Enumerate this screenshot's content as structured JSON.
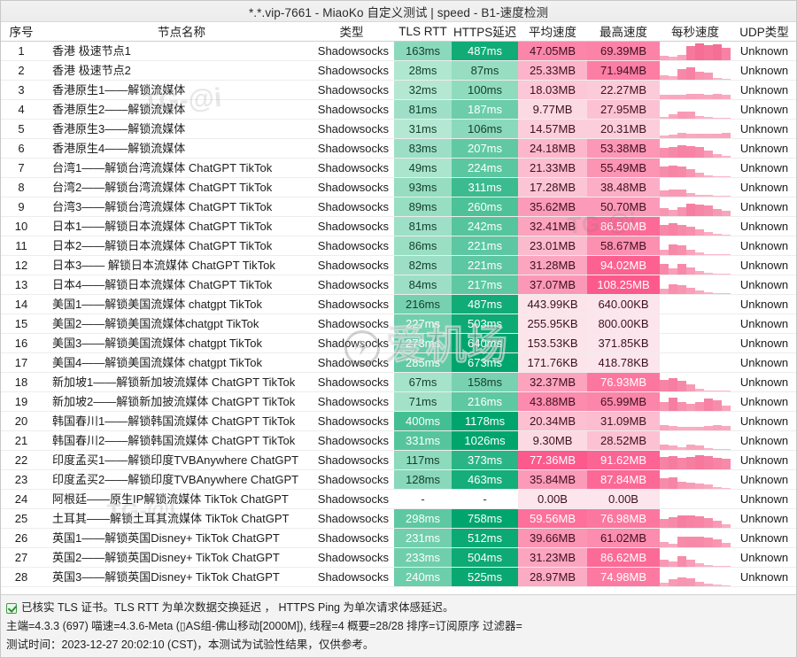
{
  "window": {
    "title": "*.*.vip-7661 - MiaoKo 自定义测试 | speed - B1-速度检测"
  },
  "columns": {
    "index": "序号",
    "name": "节点名称",
    "type": "类型",
    "tls_rtt": "TLS RTT",
    "https_ping": "HTTPS延迟",
    "avg_speed": "平均速度",
    "max_speed": "最高速度",
    "per_second": "每秒速度",
    "udp_type": "UDP类型"
  },
  "watermarks": {
    "a": "TG-@i",
    "b": "TG-@i",
    "c": "TG-@i",
    "big": "爱机场",
    "big_mark": "✈"
  },
  "rows": [
    {
      "index": "1",
      "name": "香港 极速节点1",
      "type": "Shadowsocks",
      "tls_rtt": "163ms",
      "https_ping": "487ms",
      "avg_speed": "47.05MB",
      "max_speed": "69.39MB",
      "udp_type": "Unknown",
      "rtt_shade": 0.35,
      "ping_shade": 0.92,
      "avg_shade": 0.7,
      "max_shade": 0.72,
      "spark": [
        0.25,
        0.18,
        0.3,
        0.8,
        0.95,
        0.88,
        0.92,
        0.7
      ]
    },
    {
      "index": "2",
      "name": "香港 极速节点2",
      "type": "Shadowsocks",
      "tls_rtt": "28ms",
      "https_ping": "87ms",
      "avg_speed": "25.33MB",
      "max_speed": "71.94MB",
      "udp_type": "Unknown",
      "rtt_shade": 0.18,
      "ping_shade": 0.3,
      "avg_shade": 0.38,
      "max_shade": 0.75,
      "spark": [
        0.22,
        0.18,
        0.62,
        0.7,
        0.45,
        0.4,
        0.1,
        0.05
      ]
    },
    {
      "index": "3",
      "name": "香港原生1——解锁流媒体",
      "type": "Shadowsocks",
      "tls_rtt": "32ms",
      "https_ping": "100ms",
      "avg_speed": "18.03MB",
      "max_speed": "22.27MB",
      "udp_type": "Unknown",
      "rtt_shade": 0.16,
      "ping_shade": 0.33,
      "avg_shade": 0.25,
      "max_shade": 0.22,
      "spark": [
        0.22,
        0.26,
        0.24,
        0.3,
        0.28,
        0.26,
        0.3,
        0.22
      ]
    },
    {
      "index": "4",
      "name": "香港原生2——解锁流媒体",
      "type": "Shadowsocks",
      "tls_rtt": "81ms",
      "https_ping": "187ms",
      "avg_speed": "9.77MB",
      "max_speed": "27.95MB",
      "udp_type": "Unknown",
      "rtt_shade": 0.26,
      "ping_shade": 0.5,
      "avg_shade": 0.12,
      "max_shade": 0.28,
      "spark": [
        0.08,
        0.26,
        0.42,
        0.38,
        0.12,
        0.06,
        0.04,
        0.03
      ]
    },
    {
      "index": "5",
      "name": "香港原生3——解锁流媒体",
      "type": "Shadowsocks",
      "tls_rtt": "31ms",
      "https_ping": "106ms",
      "avg_speed": "14.57MB",
      "max_speed": "20.31MB",
      "udp_type": "Unknown",
      "rtt_shade": 0.16,
      "ping_shade": 0.35,
      "avg_shade": 0.2,
      "max_shade": 0.2,
      "spark": [
        0.14,
        0.2,
        0.3,
        0.22,
        0.26,
        0.24,
        0.26,
        0.3
      ]
    },
    {
      "index": "6",
      "name": "香港原生4——解锁流媒体",
      "type": "Shadowsocks",
      "tls_rtt": "83ms",
      "https_ping": "207ms",
      "avg_speed": "24.18MB",
      "max_speed": "53.38MB",
      "udp_type": "Unknown",
      "rtt_shade": 0.27,
      "ping_shade": 0.55,
      "avg_shade": 0.36,
      "max_shade": 0.58,
      "spark": [
        0.55,
        0.62,
        0.7,
        0.68,
        0.6,
        0.4,
        0.2,
        0.08
      ]
    },
    {
      "index": "7",
      "name": "台湾1——解锁台湾流媒体 ChatGPT  TikTok",
      "type": "Shadowsocks",
      "tls_rtt": "49ms",
      "https_ping": "224ms",
      "avg_speed": "21.33MB",
      "max_speed": "55.49MB",
      "udp_type": "Unknown",
      "rtt_shade": 0.2,
      "ping_shade": 0.58,
      "avg_shade": 0.32,
      "max_shade": 0.6,
      "spark": [
        0.58,
        0.66,
        0.62,
        0.45,
        0.25,
        0.1,
        0.05,
        0.03
      ]
    },
    {
      "index": "8",
      "name": "台湾2——解锁台湾流媒体 ChatGPT  TikTok",
      "type": "Shadowsocks",
      "tls_rtt": "93ms",
      "https_ping": "311ms",
      "avg_speed": "17.28MB",
      "max_speed": "38.48MB",
      "udp_type": "Unknown",
      "rtt_shade": 0.3,
      "ping_shade": 0.72,
      "avg_shade": 0.26,
      "max_shade": 0.42,
      "spark": [
        0.35,
        0.42,
        0.4,
        0.2,
        0.1,
        0.06,
        0.04,
        0.02
      ]
    },
    {
      "index": "9",
      "name": "台湾3——解锁台湾流媒体 ChatGPT  TikTok",
      "type": "Shadowsocks",
      "tls_rtt": "89ms",
      "https_ping": "260ms",
      "avg_speed": "35.62MB",
      "max_speed": "50.70MB",
      "udp_type": "Unknown",
      "rtt_shade": 0.29,
      "ping_shade": 0.64,
      "avg_shade": 0.55,
      "max_shade": 0.55,
      "spark": [
        0.45,
        0.32,
        0.5,
        0.72,
        0.66,
        0.58,
        0.42,
        0.3
      ]
    },
    {
      "index": "10",
      "name": "日本1——解锁日本流媒体 ChatGPT  TikTok",
      "type": "Shadowsocks",
      "tls_rtt": "81ms",
      "https_ping": "242ms",
      "avg_speed": "32.41MB",
      "max_speed": "86.50MB",
      "udp_type": "Unknown",
      "rtt_shade": 0.26,
      "ping_shade": 0.6,
      "avg_shade": 0.5,
      "max_shade": 0.88,
      "spark": [
        0.62,
        0.7,
        0.6,
        0.52,
        0.35,
        0.18,
        0.08,
        0.04
      ]
    },
    {
      "index": "11",
      "name": "日本2——解锁日本流媒体 ChatGPT  TikTok",
      "type": "Shadowsocks",
      "tls_rtt": "86ms",
      "https_ping": "221ms",
      "avg_speed": "23.01MB",
      "max_speed": "58.67MB",
      "udp_type": "Unknown",
      "rtt_shade": 0.28,
      "ping_shade": 0.57,
      "avg_shade": 0.34,
      "max_shade": 0.63,
      "spark": [
        0.3,
        0.62,
        0.55,
        0.3,
        0.12,
        0.05,
        0.03,
        0.02
      ]
    },
    {
      "index": "12",
      "name": "日本3—— 解锁日本流媒体 ChatGPT  TikTok",
      "type": "Shadowsocks",
      "tls_rtt": "82ms",
      "https_ping": "221ms",
      "avg_speed": "31.28MB",
      "max_speed": "94.02MB",
      "udp_type": "Unknown",
      "rtt_shade": 0.27,
      "ping_shade": 0.57,
      "avg_shade": 0.48,
      "max_shade": 0.95,
      "spark": [
        0.62,
        0.35,
        0.6,
        0.38,
        0.2,
        0.06,
        0.03,
        0.02
      ]
    },
    {
      "index": "13",
      "name": "日本4——解锁日本流媒体 ChatGPT  TikTok",
      "type": "Shadowsocks",
      "tls_rtt": "84ms",
      "https_ping": "217ms",
      "avg_speed": "37.07MB",
      "max_speed": "108.25MB",
      "udp_type": "Unknown",
      "rtt_shade": 0.27,
      "ping_shade": 0.56,
      "avg_shade": 0.57,
      "max_shade": 1.0,
      "spark": [
        0.3,
        0.55,
        0.48,
        0.35,
        0.2,
        0.1,
        0.05,
        0.03
      ]
    },
    {
      "index": "14",
      "name": "美国1——解锁美国流媒体 chatgpt TikTok",
      "type": "Shadowsocks",
      "tls_rtt": "216ms",
      "https_ping": "487ms",
      "avg_speed": "443.99KB",
      "max_speed": "640.00KB",
      "udp_type": "Unknown",
      "rtt_shade": 0.45,
      "ping_shade": 0.92,
      "avg_shade": 0.05,
      "max_shade": 0.04,
      "spark": []
    },
    {
      "index": "15",
      "name": "美国2——解锁美国流媒体chatgpt TikTok",
      "type": "Shadowsocks",
      "tls_rtt": "227ms",
      "https_ping": "503ms",
      "avg_speed": "255.95KB",
      "max_speed": "800.00KB",
      "udp_type": "Unknown",
      "rtt_shade": 0.47,
      "ping_shade": 0.94,
      "avg_shade": 0.05,
      "max_shade": 0.04,
      "spark": []
    },
    {
      "index": "16",
      "name": "美国3——解锁美国流媒体 chatgpt TikTok",
      "type": "Shadowsocks",
      "tls_rtt": "273ms",
      "https_ping": "640ms",
      "avg_speed": "153.53KB",
      "max_speed": "371.85KB",
      "udp_type": "Unknown",
      "rtt_shade": 0.52,
      "ping_shade": 1.0,
      "avg_shade": 0.05,
      "max_shade": 0.04,
      "spark": []
    },
    {
      "index": "17",
      "name": "美国4——解锁美国流媒体 chatgpt TikTok",
      "type": "Shadowsocks",
      "tls_rtt": "285ms",
      "https_ping": "673ms",
      "avg_speed": "171.76KB",
      "max_speed": "418.78KB",
      "udp_type": "Unknown",
      "rtt_shade": 0.54,
      "ping_shade": 1.0,
      "avg_shade": 0.05,
      "max_shade": 0.04,
      "spark": []
    },
    {
      "index": "18",
      "name": "新加坡1——解锁新加坡流媒体 ChatGPT  TikTok",
      "type": "Shadowsocks",
      "tls_rtt": "67ms",
      "https_ping": "158ms",
      "avg_speed": "32.37MB",
      "max_speed": "76.93MB",
      "udp_type": "Unknown",
      "rtt_shade": 0.23,
      "ping_shade": 0.44,
      "avg_shade": 0.5,
      "max_shade": 0.8,
      "spark": [
        0.68,
        0.74,
        0.62,
        0.4,
        0.12,
        0.05,
        0.03,
        0.02
      ]
    },
    {
      "index": "19",
      "name": "新加坡2——解锁新加披流媒体 ChatGPT  TikTok",
      "type": "Shadowsocks",
      "tls_rtt": "71ms",
      "https_ping": "216ms",
      "avg_speed": "43.88MB",
      "max_speed": "65.99MB",
      "udp_type": "Unknown",
      "rtt_shade": 0.24,
      "ping_shade": 0.56,
      "avg_shade": 0.66,
      "max_shade": 0.7,
      "spark": [
        0.48,
        0.74,
        0.52,
        0.4,
        0.52,
        0.7,
        0.58,
        0.3
      ]
    },
    {
      "index": "20",
      "name": "韩国春川1——解锁韩国流媒体 ChatGPT  TikTok",
      "type": "Shadowsocks",
      "tls_rtt": "400ms",
      "https_ping": "1178ms",
      "avg_speed": "20.34MB",
      "max_speed": "31.09MB",
      "udp_type": "Unknown",
      "rtt_shade": 0.68,
      "ping_shade": 1.0,
      "avg_shade": 0.3,
      "max_shade": 0.32,
      "spark": [
        0.28,
        0.22,
        0.18,
        0.16,
        0.2,
        0.26,
        0.3,
        0.24
      ]
    },
    {
      "index": "21",
      "name": "韩国春川2——解锁韩国流媒体 ChatGPT  TikTok",
      "type": "Shadowsocks",
      "tls_rtt": "331ms",
      "https_ping": "1026ms",
      "avg_speed": "9.30MB",
      "max_speed": "28.52MB",
      "udp_type": "Unknown",
      "rtt_shade": 0.6,
      "ping_shade": 1.0,
      "avg_shade": 0.12,
      "max_shade": 0.29,
      "spark": [
        0.3,
        0.22,
        0.12,
        0.28,
        0.26,
        0.1,
        0.04,
        0.02
      ]
    },
    {
      "index": "22",
      "name": "印度孟买1——解锁印度TVBAnywhere  ChatGPT",
      "type": "Shadowsocks",
      "tls_rtt": "117ms",
      "https_ping": "373ms",
      "avg_speed": "77.36MB",
      "max_speed": "91.62MB",
      "udp_type": "Unknown",
      "rtt_shade": 0.34,
      "ping_shade": 0.8,
      "avg_shade": 1.0,
      "max_shade": 0.93,
      "spark": [
        0.7,
        0.76,
        0.66,
        0.72,
        0.8,
        0.74,
        0.68,
        0.6
      ]
    },
    {
      "index": "23",
      "name": "印度孟买2——解锁印度TVBAnywhere  ChatGPT",
      "type": "Shadowsocks",
      "tls_rtt": "128ms",
      "https_ping": "463ms",
      "avg_speed": "35.84MB",
      "max_speed": "87.84MB",
      "udp_type": "Unknown",
      "rtt_shade": 0.36,
      "ping_shade": 0.9,
      "avg_shade": 0.55,
      "max_shade": 0.9,
      "spark": [
        0.58,
        0.66,
        0.42,
        0.36,
        0.3,
        0.22,
        0.1,
        0.05
      ]
    },
    {
      "index": "24",
      "name": "阿根廷——原生IP解锁流媒体 TikTok  ChatGPT",
      "type": "Shadowsocks",
      "tls_rtt": "-",
      "https_ping": "-",
      "avg_speed": "0.00B",
      "max_speed": "0.00B",
      "udp_type": "Unknown",
      "rtt_shade": 0,
      "ping_shade": 0,
      "avg_shade": 0.04,
      "max_shade": 0.04,
      "spark": []
    },
    {
      "index": "25",
      "name": "土耳其——解锁土耳其流媒体 TikTok ChatGPT",
      "type": "Shadowsocks",
      "tls_rtt": "298ms",
      "https_ping": "758ms",
      "avg_speed": "59.56MB",
      "max_speed": "76.98MB",
      "udp_type": "Unknown",
      "rtt_shade": 0.56,
      "ping_shade": 1.0,
      "avg_shade": 0.85,
      "max_shade": 0.8,
      "spark": [
        0.52,
        0.6,
        0.72,
        0.7,
        0.66,
        0.56,
        0.4,
        0.2
      ]
    },
    {
      "index": "26",
      "name": "英国1——解锁英国Disney+ TikTok  ChatGPT",
      "type": "Shadowsocks",
      "tls_rtt": "231ms",
      "https_ping": "512ms",
      "avg_speed": "39.66MB",
      "max_speed": "61.02MB",
      "udp_type": "Unknown",
      "rtt_shade": 0.47,
      "ping_shade": 0.95,
      "avg_shade": 0.6,
      "max_shade": 0.65,
      "spark": [
        0.3,
        0.2,
        0.58,
        0.62,
        0.6,
        0.55,
        0.46,
        0.24
      ]
    },
    {
      "index": "27",
      "name": "英国2——解锁英国Disney+ TikTok  ChatGPT",
      "type": "Shadowsocks",
      "tls_rtt": "233ms",
      "https_ping": "504ms",
      "avg_speed": "31.23MB",
      "max_speed": "86.62MB",
      "udp_type": "Unknown",
      "rtt_shade": 0.48,
      "ping_shade": 0.94,
      "avg_shade": 0.48,
      "max_shade": 0.88,
      "spark": [
        0.42,
        0.3,
        0.58,
        0.38,
        0.18,
        0.08,
        0.04,
        0.02
      ]
    },
    {
      "index": "28",
      "name": "英国3——解锁英国Disney+ TikTok  ChatGPT",
      "type": "Shadowsocks",
      "tls_rtt": "240ms",
      "https_ping": "525ms",
      "avg_speed": "28.97MB",
      "max_speed": "74.98MB",
      "udp_type": "Unknown",
      "rtt_shade": 0.49,
      "ping_shade": 0.96,
      "avg_shade": 0.44,
      "max_shade": 0.78,
      "spark": [
        0.18,
        0.4,
        0.48,
        0.44,
        0.26,
        0.14,
        0.06,
        0.03
      ]
    }
  ],
  "footer": {
    "line1": "已核实 TLS 证书。TLS RTT 为单次数据交换延迟 ， HTTPS Ping 为单次请求体感延迟。",
    "line2": "主端=4.3.3 (697) 喵速=4.3.6-Meta (▯AS组-佛山移动[2000M]), 线程=4 概要=28/28 排序=订阅原序 过滤器=",
    "line3": "测试时间：2023-12-27 20:02:10 (CST)，本测试为试验性结果，仅供参考。"
  },
  "colors": {
    "green": "#16b877",
    "pink": "#f2618c",
    "check": "#3d9c46"
  }
}
